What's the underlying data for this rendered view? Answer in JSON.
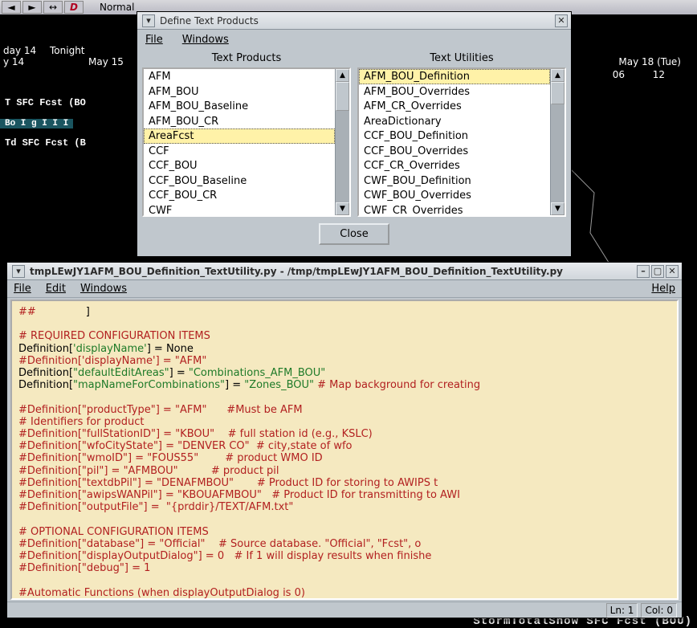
{
  "bg": {
    "toolbar_normal": "Normal",
    "day_labels": [
      "day 14",
      "Tonight",
      "May 15"
    ],
    "right_date": "May 18 (Tue)",
    "hours_right": [
      "06",
      "12"
    ],
    "sfc1": "T SFC  Fcst (BO",
    "sfc2": "Td SFC  Fcst (B",
    "bo_ig": "Bo I g I I  I",
    "corner": "StormTotalSnow SFC Fcst (BOU)"
  },
  "dtp": {
    "title": "Define Text Products",
    "menu": {
      "file": "File",
      "windows": "Windows"
    },
    "col_products": "Text Products",
    "col_utilities": "Text Utilities",
    "products": [
      "AFM",
      "AFM_BOU",
      "AFM_BOU_Baseline",
      "AFM_BOU_CR",
      "AreaFcst",
      "CCF",
      "CCF_BOU",
      "CCF_BOU_Baseline",
      "CCF_BOU_CR",
      "CWF"
    ],
    "products_selected_index": 4,
    "utilities": [
      "AFM_BOU_Definition",
      "AFM_BOU_Overrides",
      "AFM_CR_Overrides",
      "AreaDictionary",
      "CCF_BOU_Definition",
      "CCF_BOU_Overrides",
      "CCF_CR_Overrides",
      "CWF_BOU_Definition",
      "CWF_BOU_Overrides",
      "CWF_CR_Overrides"
    ],
    "utilities_selected_index": 0,
    "close": "Close"
  },
  "editor": {
    "title": "tmpLEwJY1AFM_BOU_Definition_TextUtility.py - /tmp/tmpLEwJY1AFM_BOU_Definition_TextUtility.py",
    "menu": {
      "file": "File",
      "edit": "Edit",
      "windows": "Windows",
      "help": "Help"
    },
    "status": {
      "ln": "Ln: 1",
      "col": "Col: 0"
    },
    "lines": [
      {
        "segs": [
          {
            "t": "##",
            "c": "red"
          },
          {
            "t": "               ]",
            "c": "black"
          }
        ]
      },
      {
        "segs": []
      },
      {
        "segs": [
          {
            "t": "# REQUIRED CONFIGURATION ITEMS",
            "c": "red"
          }
        ]
      },
      {
        "segs": [
          {
            "t": "Definition[",
            "c": "black"
          },
          {
            "t": "'displayName'",
            "c": "green"
          },
          {
            "t": "] = ",
            "c": "black"
          },
          {
            "t": "None",
            "c": "black"
          }
        ]
      },
      {
        "segs": [
          {
            "t": "#Definition['displayName'] = \"AFM\"",
            "c": "red"
          }
        ]
      },
      {
        "segs": [
          {
            "t": "Definition[",
            "c": "black"
          },
          {
            "t": "\"defaultEditAreas\"",
            "c": "green"
          },
          {
            "t": "] = ",
            "c": "black"
          },
          {
            "t": "\"Combinations_AFM_BOU\"",
            "c": "green"
          }
        ]
      },
      {
        "segs": [
          {
            "t": "Definition[",
            "c": "black"
          },
          {
            "t": "\"mapNameForCombinations\"",
            "c": "green"
          },
          {
            "t": "] = ",
            "c": "black"
          },
          {
            "t": "\"Zones_BOU\"",
            "c": "green"
          },
          {
            "t": " ",
            "c": "black"
          },
          {
            "t": "# Map background for creating",
            "c": "red"
          }
        ]
      },
      {
        "segs": []
      },
      {
        "segs": [
          {
            "t": "#Definition[\"productType\"] = \"AFM\"      #Must be AFM",
            "c": "red"
          }
        ]
      },
      {
        "segs": [
          {
            "t": "# Identifiers for product",
            "c": "red"
          }
        ]
      },
      {
        "segs": [
          {
            "t": "#Definition[\"fullStationID\"] = \"KBOU\"    # full station id (e.g., KSLC)",
            "c": "red"
          }
        ]
      },
      {
        "segs": [
          {
            "t": "#Definition[\"wfoCityState\"] = \"DENVER CO\"  # city,state of wfo",
            "c": "red"
          }
        ]
      },
      {
        "segs": [
          {
            "t": "#Definition[\"wmoID\"] = \"FOUS55\"        # product WMO ID",
            "c": "red"
          }
        ]
      },
      {
        "segs": [
          {
            "t": "#Definition[\"pil\"] = \"AFMBOU\"          # product pil",
            "c": "red"
          }
        ]
      },
      {
        "segs": [
          {
            "t": "#Definition[\"textdbPil\"] = \"DENAFMBOU\"       # Product ID for storing to AWIPS t",
            "c": "red"
          }
        ]
      },
      {
        "segs": [
          {
            "t": "#Definition[\"awipsWANPil\"] = \"KBOUAFMBOU\"   # Product ID for transmitting to AWI",
            "c": "red"
          }
        ]
      },
      {
        "segs": [
          {
            "t": "#Definition[\"outputFile\"] =  \"{prddir}/TEXT/AFM.txt\"",
            "c": "red"
          }
        ]
      },
      {
        "segs": []
      },
      {
        "segs": [
          {
            "t": "# OPTIONAL CONFIGURATION ITEMS",
            "c": "red"
          }
        ]
      },
      {
        "segs": [
          {
            "t": "#Definition[\"database\"] = \"Official\"    # Source database. \"Official\", \"Fcst\", o",
            "c": "red"
          }
        ]
      },
      {
        "segs": [
          {
            "t": "#Definition[\"displayOutputDialog\"] = 0   # If 1 will display results when finishe",
            "c": "red"
          }
        ]
      },
      {
        "segs": [
          {
            "t": "#Definition[\"debug\"] = 1",
            "c": "red"
          }
        ]
      },
      {
        "segs": []
      },
      {
        "segs": [
          {
            "t": "#Automatic Functions (when displayOutputDialog is 0)",
            "c": "red"
          }
        ]
      }
    ]
  }
}
